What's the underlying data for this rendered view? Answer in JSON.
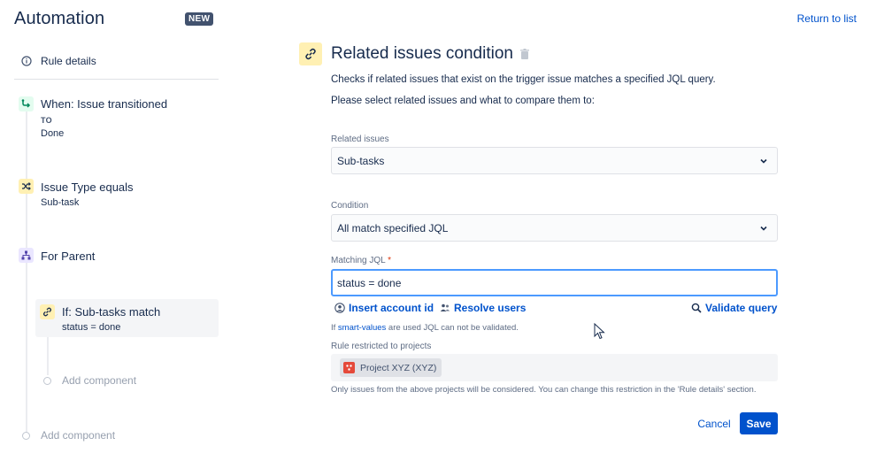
{
  "header": {
    "app_title": "Automation",
    "badge": "NEW",
    "return_link": "Return to list"
  },
  "sidebar": {
    "rule_details": "Rule details",
    "steps": [
      {
        "title": "When: Issue transitioned",
        "to_label": "TO",
        "sub": "Done",
        "icon": "transition-icon"
      },
      {
        "title": "Issue Type equals",
        "sub": "Sub-task",
        "icon": "shuffle-icon"
      },
      {
        "title": "For Parent",
        "icon": "hierarchy-icon"
      },
      {
        "title": "If: Sub-tasks match",
        "sub": "status = done",
        "icon": "link-icon"
      }
    ],
    "add_component_inner": "Add component",
    "add_component_outer": "Add component"
  },
  "panel": {
    "title": "Related issues condition",
    "desc1": "Checks if related issues that exist on the trigger issue matches a specified JQL query.",
    "desc2": "Please select related issues and what to compare them to:",
    "related_label": "Related issues",
    "related_value": "Sub-tasks",
    "condition_label": "Condition",
    "condition_value": "All match specified JQL",
    "jql_label": "Matching JQL",
    "jql_required": "*",
    "jql_value": "status = done",
    "insert_account": "Insert account id",
    "resolve_users": "Resolve users",
    "validate_query": "Validate query",
    "hint_prefix": "If ",
    "hint_link": "smart-values",
    "hint_suffix": " are used JQL can not be validated.",
    "restricted_label": "Rule restricted to projects",
    "project_chip": "Project XYZ (XYZ)",
    "restricted_note": "Only issues from the above projects will be considered. You can change this restriction in the 'Rule details' section.",
    "cancel": "Cancel",
    "save": "Save"
  },
  "colors": {
    "primary": "#0052cc",
    "text": "#172b4d",
    "muted": "#5e6c84",
    "focus": "#4c9aff",
    "condition_icon_bg": "#fff0b3",
    "trigger_icon_bg": "#e3fcef",
    "branch_icon_bg": "#eae6ff",
    "project_avatar": "#e5493a"
  }
}
